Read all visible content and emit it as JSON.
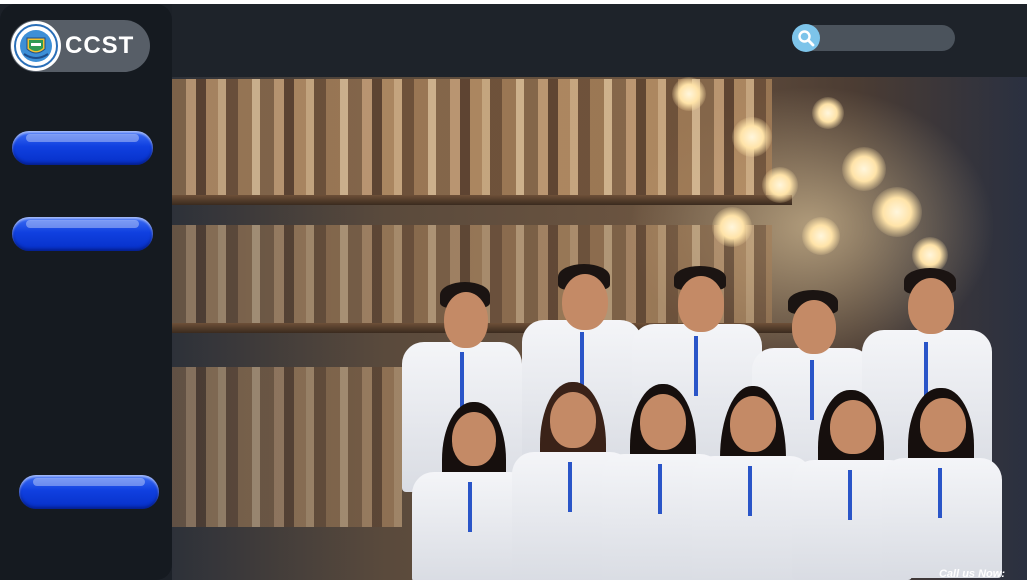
{
  "brand": {
    "name": "CCST",
    "logo_icon": "school-seal-icon"
  },
  "sidebar": {
    "buttons": [
      {
        "label": ""
      },
      {
        "label": ""
      },
      {
        "label": ""
      }
    ]
  },
  "header": {
    "search": {
      "icon": "search-icon",
      "placeholder": "",
      "value": ""
    }
  },
  "hero": {
    "image_icon": "students-library-photo",
    "call_text": "Call us Now:"
  },
  "colors": {
    "sidebar": "#151a20",
    "header": "#1e232a",
    "button_blue": "#1040e0",
    "search_icon_bg": "#7dc4ea",
    "brand_pill": "#575e67"
  }
}
